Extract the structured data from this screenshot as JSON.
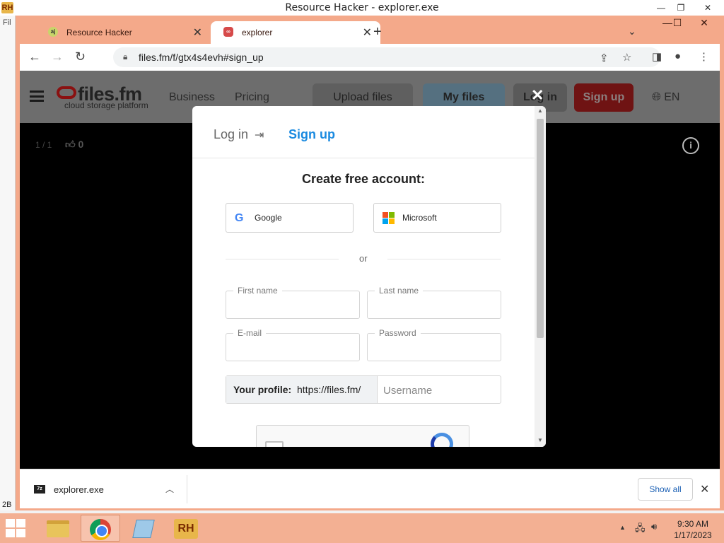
{
  "outer_window": {
    "title": "Resource Hacker - explorer.exe",
    "logo": "RH",
    "menu_fragment": "Fil",
    "status_fragment": "2B",
    "controls": {
      "minimize": "—",
      "restore": "❐",
      "close": "✕"
    }
  },
  "browser": {
    "tabs": [
      {
        "title": "Resource Hacker",
        "icon": "aj",
        "icon_color": "#c8d46a",
        "active": false
      },
      {
        "title": "explorer",
        "icon": "∞",
        "icon_color": "#d64a4a",
        "active": true
      }
    ],
    "new_tab": "+",
    "tab_dropdown": "⌄",
    "window_controls": {
      "minimize": "—",
      "maximize": "☐",
      "close": "✕"
    },
    "nav": {
      "back": "←",
      "forward": "→",
      "reload": "↻"
    },
    "url": "files.fm/f/gtx4s4evh#sign_up",
    "toolbar_icons": {
      "share": "⇪",
      "bookmark": "☆",
      "sidepanel": "◨",
      "profile": "●",
      "menu": "⋮"
    }
  },
  "site": {
    "logo_text": "files.fm",
    "logo_sub": "cloud storage platform",
    "nav_links": [
      "Business",
      "Pricing"
    ],
    "buttons": {
      "upload": "Upload files",
      "myfiles": "My files",
      "login": "Log in",
      "signup": "Sign up"
    },
    "language": "EN",
    "counter": "1 / 1",
    "likes": "0",
    "info": "i",
    "close_modal": "✕"
  },
  "modal": {
    "tab_login": "Log in",
    "tab_signup": "Sign up",
    "title": "Create free account:",
    "social": {
      "google": "Google",
      "microsoft": "Microsoft"
    },
    "or": "or",
    "fields": {
      "first_name": "First name",
      "last_name": "Last name",
      "email": "E-mail",
      "password": "Password"
    },
    "profile": {
      "label": "Your profile:",
      "url_prefix": "https://files.fm/",
      "username_placeholder": "Username"
    }
  },
  "download_shelf": {
    "file_name": "explorer.exe",
    "file_icon": "7z",
    "show_all": "Show all",
    "close": "✕"
  },
  "taskbar": {
    "time": "9:30 AM",
    "date": "1/17/2023",
    "rh_label": "RH"
  },
  "colors": {
    "accent_blue": "#1a8ae0",
    "chrome_frame": "#f4a98a",
    "signup_red": "#6f1313"
  }
}
